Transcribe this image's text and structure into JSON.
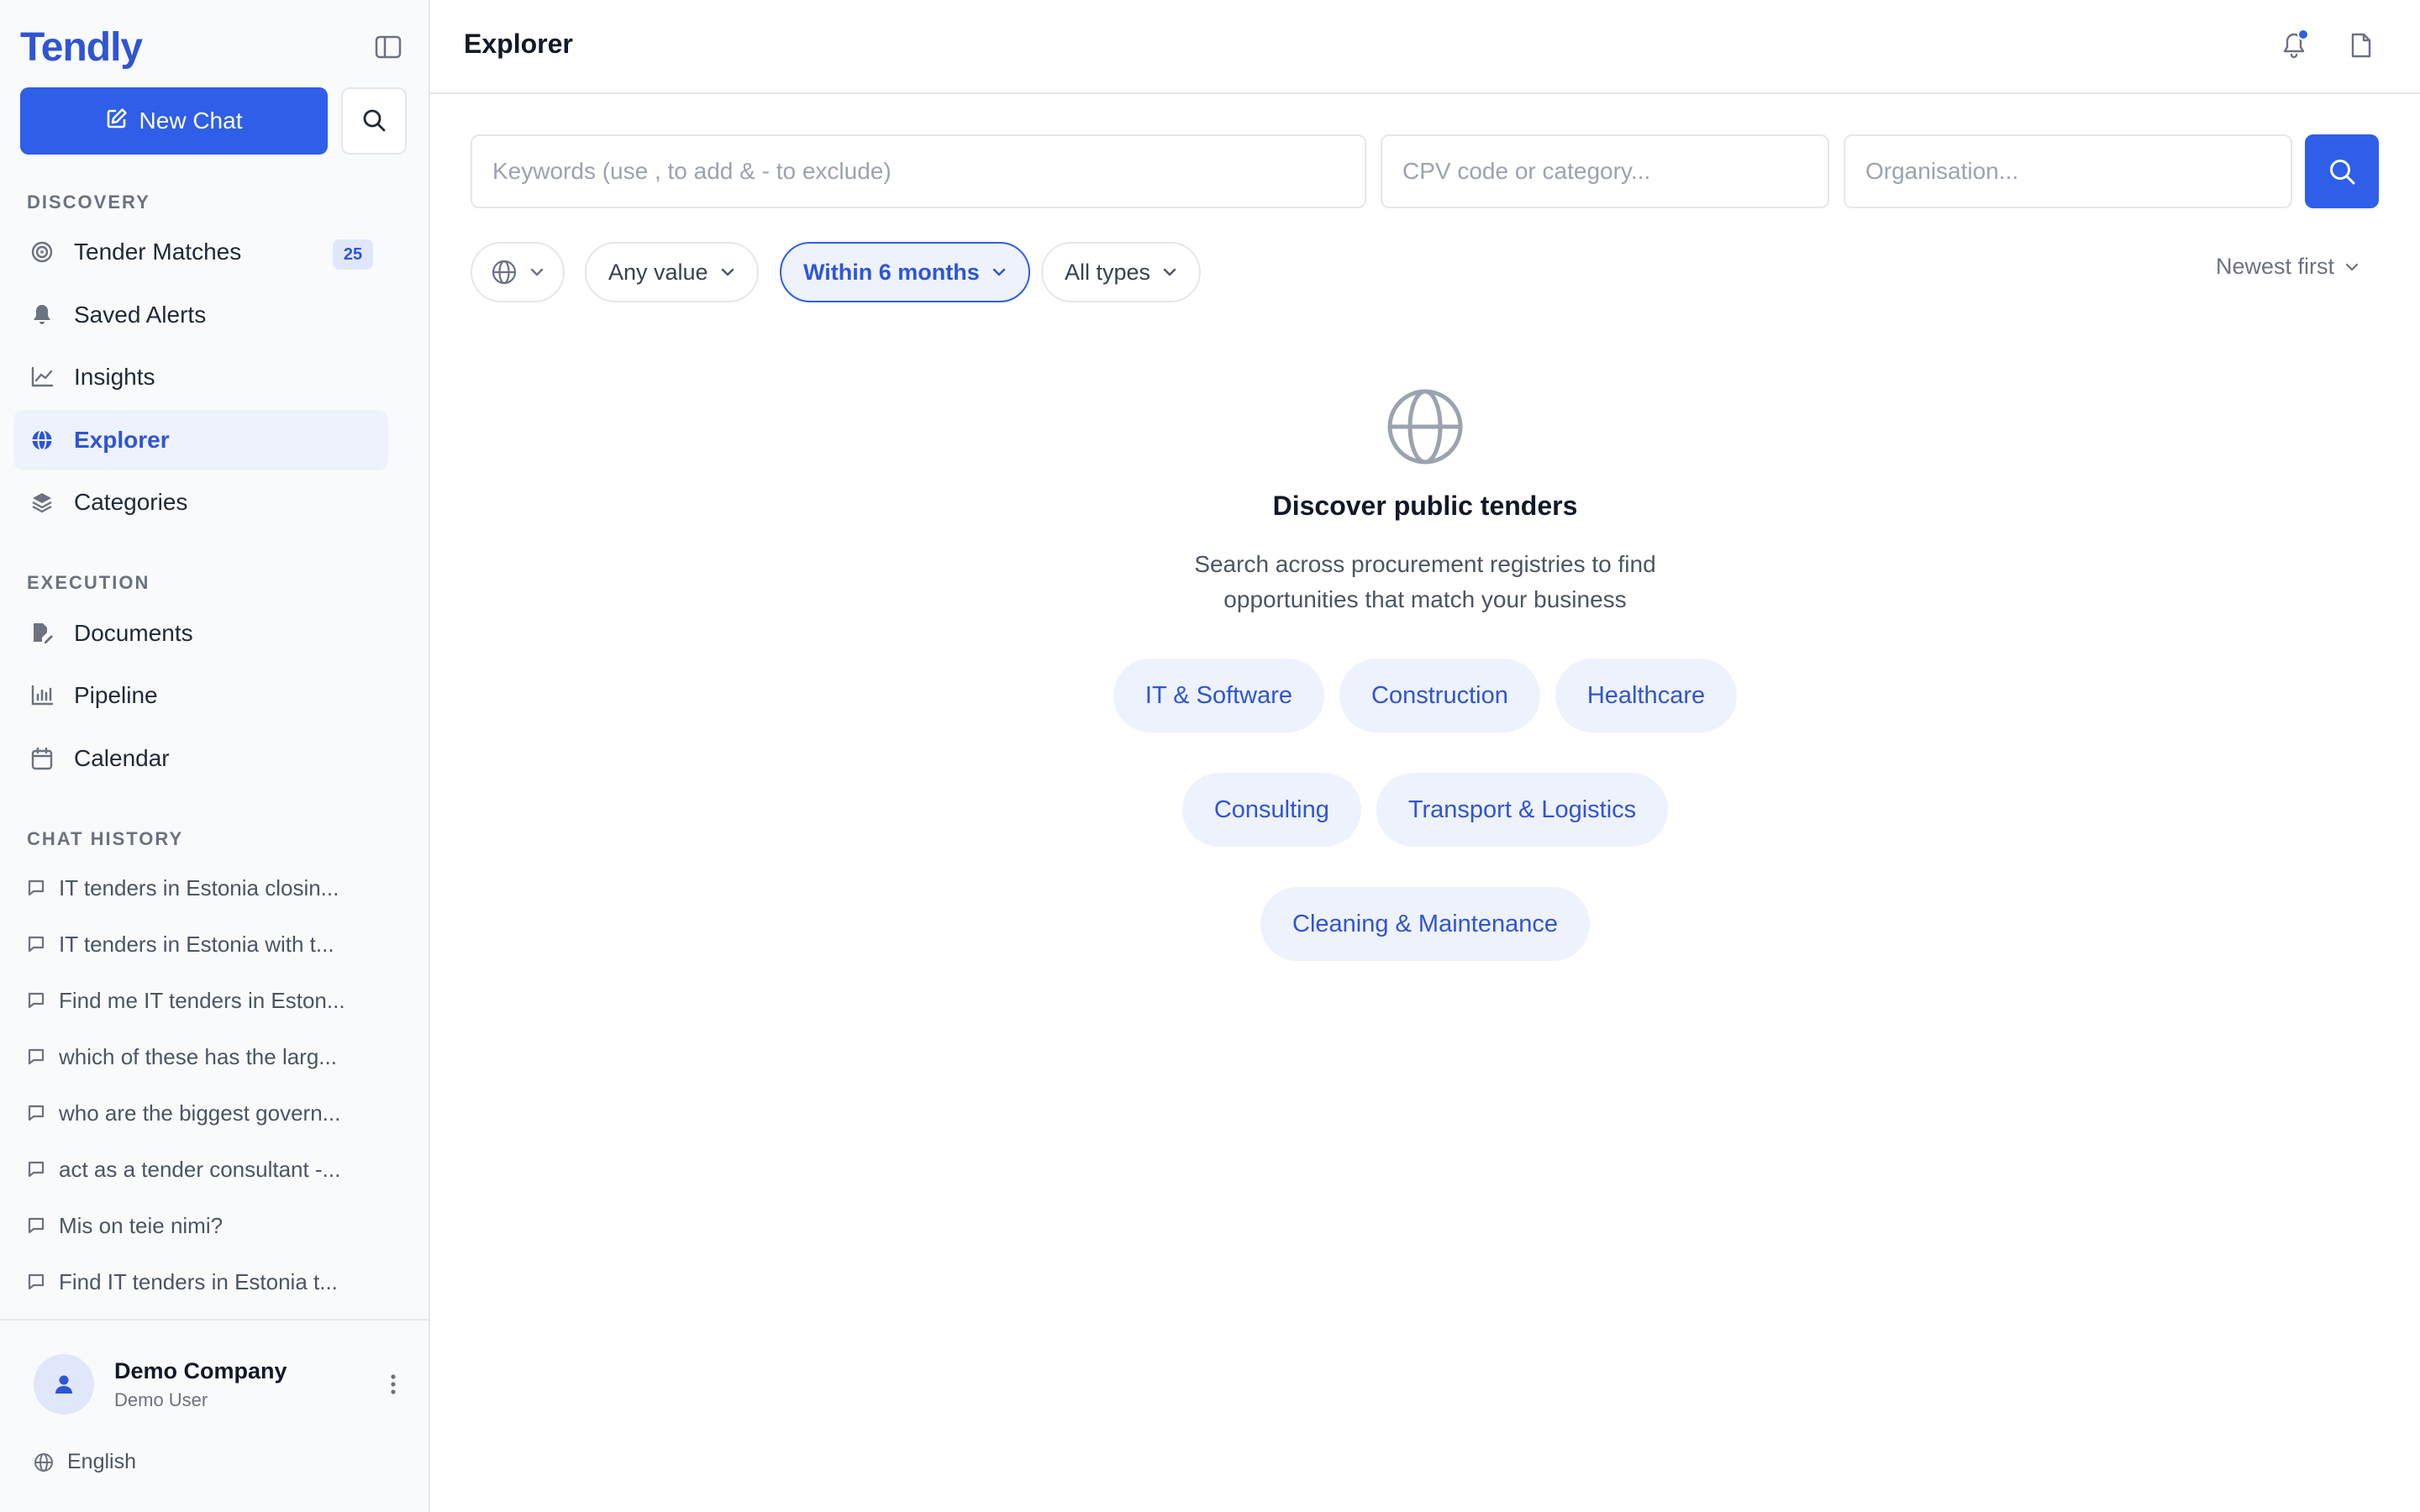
{
  "brand": "Tendly",
  "new_chat_label": "New Chat",
  "sections": {
    "discovery": "DISCOVERY",
    "execution": "EXECUTION",
    "chat_history": "CHAT HISTORY"
  },
  "nav": {
    "tender_matches": {
      "label": "Tender Matches",
      "badge": "25",
      "icon": "target-icon"
    },
    "saved_alerts": {
      "label": "Saved Alerts",
      "icon": "bell-icon"
    },
    "insights": {
      "label": "Insights",
      "icon": "line-chart-icon"
    },
    "explorer": {
      "label": "Explorer",
      "icon": "globe-icon"
    },
    "categories": {
      "label": "Categories",
      "icon": "layers-icon"
    },
    "documents": {
      "label": "Documents",
      "icon": "document-edit-icon"
    },
    "pipeline": {
      "label": "Pipeline",
      "icon": "bar-chart-icon"
    },
    "calendar": {
      "label": "Calendar",
      "icon": "calendar-icon"
    }
  },
  "chat_history": [
    "IT tenders in Estonia closin...",
    "IT tenders in Estonia with t...",
    "Find me IT tenders in Eston...",
    "which of these has the larg...",
    "who are the biggest govern...",
    "act as a tender consultant -...",
    "Mis on teie nimi?",
    "Find IT tenders in Estonia t..."
  ],
  "user": {
    "company": "Demo Company",
    "name": "Demo User"
  },
  "language": "English",
  "header": {
    "title": "Explorer"
  },
  "search": {
    "keywords_placeholder": "Keywords (use , to add & - to exclude)",
    "cpv_placeholder": "CPV code or category...",
    "org_placeholder": "Organisation..."
  },
  "filters": {
    "value": "Any value",
    "timeframe": "Within 6 months",
    "types": "All types",
    "sort": "Newest first"
  },
  "empty_state": {
    "title": "Discover public tenders",
    "description": "Search across procurement registries to find opportunities that match your business"
  },
  "categories": [
    "IT & Software",
    "Construction",
    "Healthcare",
    "Consulting",
    "Transport & Logistics",
    "Cleaning & Maintenance"
  ],
  "colors": {
    "accent": "#2f5ee8",
    "accent_text": "#2f55d4",
    "accent_soft": "#eef2fc"
  }
}
